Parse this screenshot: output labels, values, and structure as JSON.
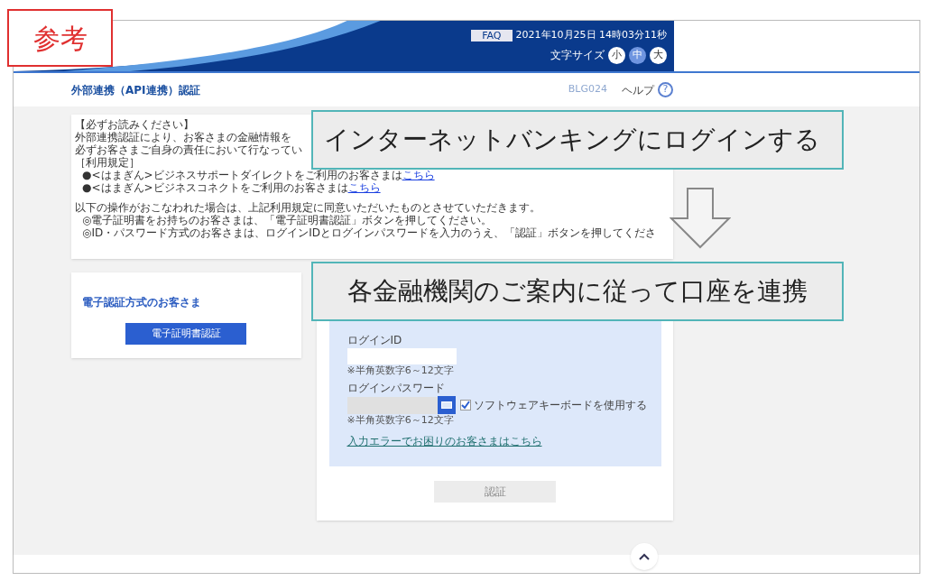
{
  "stamp": "参考",
  "header": {
    "faq": "FAQ",
    "datetime": "2021年10月25日 14時03分11秒",
    "font_size_label": "文字サイズ",
    "font_sizes": [
      {
        "label": "小",
        "selected": false
      },
      {
        "label": "中",
        "selected": true
      },
      {
        "label": "大",
        "selected": false
      }
    ]
  },
  "title_bar": {
    "title": "外部連携（API連携）認証",
    "screen_id": "BLG024",
    "help": "ヘルプ",
    "help_icon": "?"
  },
  "notice": {
    "lines": [
      {
        "kind": "text",
        "text": "【必ずお読みください】"
      },
      {
        "kind": "text",
        "text": "外部連携認証により、お客さまの金融情報を"
      },
      {
        "kind": "text",
        "text": "必ずお客さまご自身の責任において行なってい"
      },
      {
        "kind": "text",
        "text": "［利用規定］"
      },
      {
        "kind": "bullet",
        "text": "●<はまぎん>ビジネスサポートダイレクトをご利用のお客さまは",
        "link": "こちら"
      },
      {
        "kind": "bullet",
        "text": "●<はまぎん>ビジネスコネクトをご利用のお客さまは",
        "link": "こちら"
      },
      {
        "kind": "gap_text",
        "text": "以下の操作がおこなわれた場合は、上記利用規定に同意いただいたものとさせていただきます。"
      },
      {
        "kind": "note",
        "text": "◎電子証明書をお持ちのお客さまは、「電子証明書認証」ボタンを押してください。"
      },
      {
        "kind": "note",
        "text": "◎ID・パスワード方式のお客さまは、ログインIDとログインパスワードを入力のうえ、「認証」ボタンを押してくださ"
      }
    ]
  },
  "certificate_card": {
    "heading": "電子認証方式のお客さま",
    "button": "電子証明書認証"
  },
  "login_form": {
    "id_label": "ログインID",
    "id_hint": "※半角英数字6～12文字",
    "password_label": "ログインパスワード",
    "password_hint": "※半角英数字6～12文字",
    "software_keyboard": {
      "label": "ソフトウェアキーボードを使用する",
      "checked": true
    },
    "help_link": "入力エラーでお困りのお客さまはこちら",
    "submit": "認証"
  },
  "callouts": [
    "インターネットバンキングにログインする",
    "各金融機関のご案内に従って口座を連携"
  ]
}
